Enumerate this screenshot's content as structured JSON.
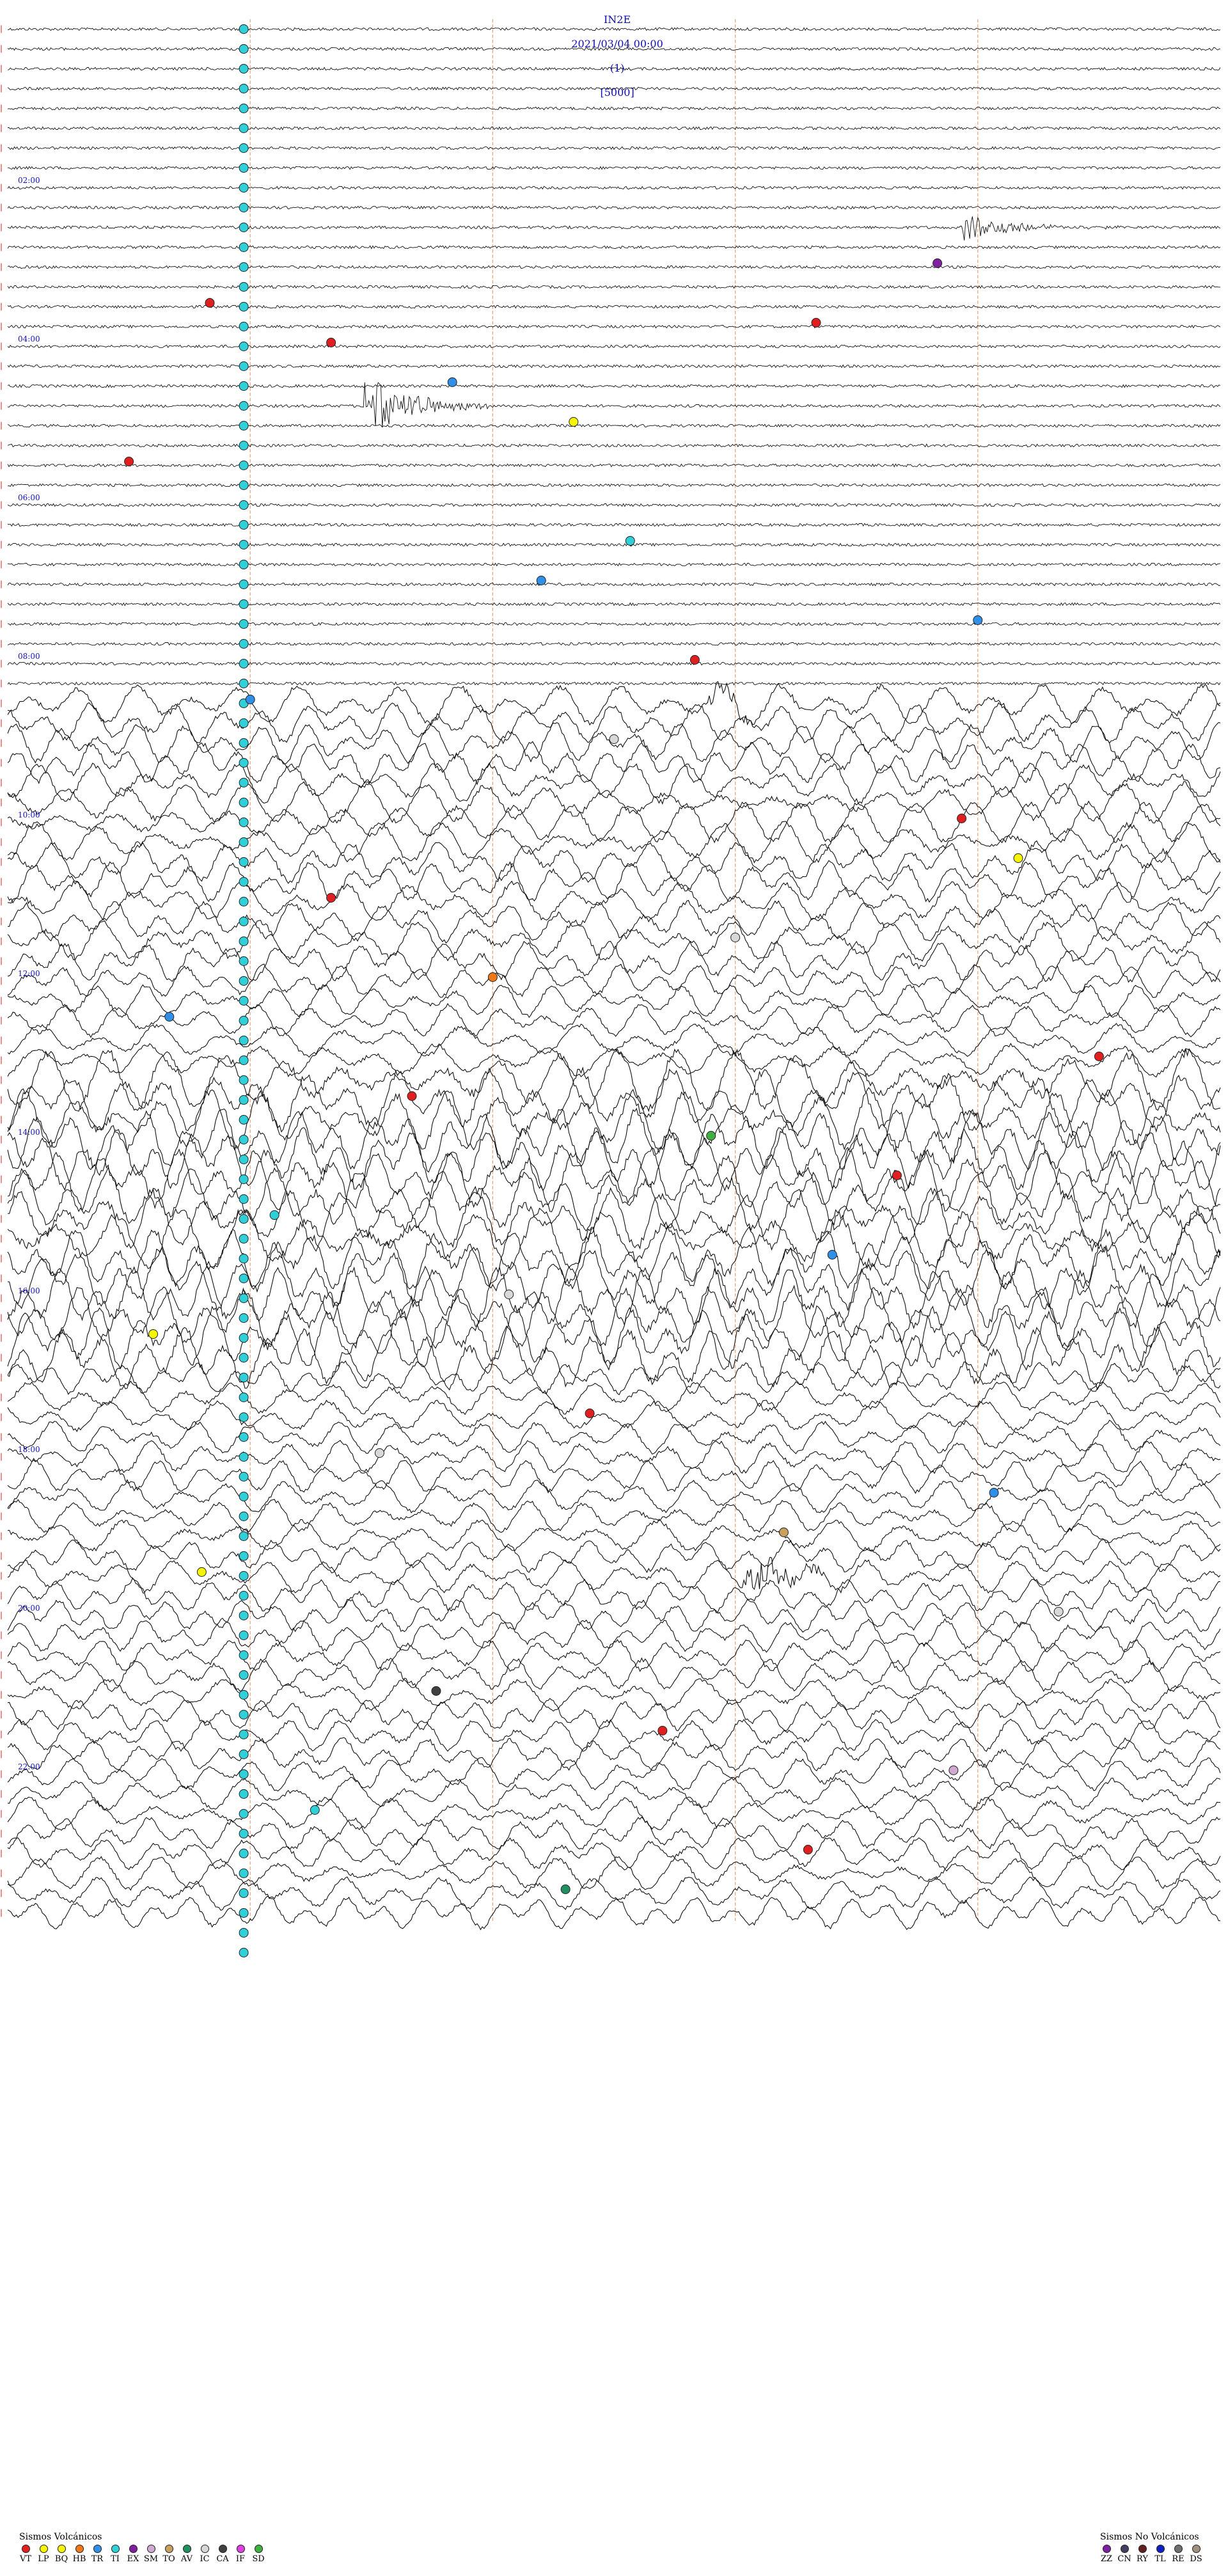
{
  "header": {
    "station": "IN2E",
    "datetime": "2021/03/04 00:00",
    "filter": "(1)",
    "scale": "[5000]"
  },
  "chart_data": {
    "type": "line",
    "time_labels": [
      "02:00",
      "04:00",
      "06:00",
      "08:00",
      "10:00",
      "12:00",
      "14:00",
      "16:00",
      "18:00",
      "20:00",
      "22:00"
    ],
    "rows": 96,
    "minutes_per_row": 15,
    "quiet_hours": [
      0,
      8.5
    ],
    "noisy_hours": [
      8.5,
      24
    ],
    "events": [
      {
        "row": 12,
        "minute": 11.5,
        "type": "EX"
      },
      {
        "row": 14,
        "minute": 2.5,
        "type": "VT"
      },
      {
        "row": 16,
        "minute": 4,
        "type": "VT"
      },
      {
        "row": 15,
        "minute": 10,
        "type": "VT"
      },
      {
        "row": 18,
        "minute": 5.5,
        "type": "TR"
      },
      {
        "row": 20,
        "minute": 7,
        "type": "BQ"
      },
      {
        "row": 22,
        "minute": 1.5,
        "type": "VT"
      },
      {
        "row": 26,
        "minute": 7.7,
        "type": "TI"
      },
      {
        "row": 28,
        "minute": 6.6,
        "type": "TR"
      },
      {
        "row": 30,
        "minute": 12,
        "type": "TR"
      },
      {
        "row": 32,
        "minute": 8.5,
        "type": "VT"
      },
      {
        "row": 34,
        "minute": 3,
        "type": "TR"
      },
      {
        "row": 36,
        "minute": 7.5,
        "type": "IC"
      },
      {
        "row": 40,
        "minute": 11.8,
        "type": "VT"
      },
      {
        "row": 42,
        "minute": 12.5,
        "type": "BQ"
      },
      {
        "row": 44,
        "minute": 4,
        "type": "VT"
      },
      {
        "row": 46,
        "minute": 9,
        "type": "IC"
      },
      {
        "row": 48,
        "minute": 6,
        "type": "HB"
      },
      {
        "row": 50,
        "minute": 2,
        "type": "TR"
      },
      {
        "row": 52,
        "minute": 13.5,
        "type": "VT"
      },
      {
        "row": 54,
        "minute": 5,
        "type": "VT"
      },
      {
        "row": 56,
        "minute": 8.7,
        "type": "SD"
      },
      {
        "row": 58,
        "minute": 11,
        "type": "VT"
      },
      {
        "row": 60,
        "minute": 3.3,
        "type": "TI"
      },
      {
        "row": 62,
        "minute": 10.2,
        "type": "TR"
      },
      {
        "row": 64,
        "minute": 6.2,
        "type": "IC"
      },
      {
        "row": 66,
        "minute": 1.8,
        "type": "BQ"
      },
      {
        "row": 70,
        "minute": 7.2,
        "type": "VT"
      },
      {
        "row": 72,
        "minute": 4.6,
        "type": "IC"
      },
      {
        "row": 74,
        "minute": 12.2,
        "type": "TR"
      },
      {
        "row": 76,
        "minute": 9.6,
        "type": "TO"
      },
      {
        "row": 78,
        "minute": 2.4,
        "type": "LP"
      },
      {
        "row": 80,
        "minute": 13,
        "type": "IC"
      },
      {
        "row": 84,
        "minute": 5.3,
        "type": "CA"
      },
      {
        "row": 86,
        "minute": 8.1,
        "type": "VT"
      },
      {
        "row": 88,
        "minute": 11.7,
        "type": "SM"
      },
      {
        "row": 90,
        "minute": 3.8,
        "type": "TI"
      },
      {
        "row": 92,
        "minute": 9.9,
        "type": "VT"
      },
      {
        "row": 94,
        "minute": 6.9,
        "type": "AV"
      }
    ],
    "signals": [
      {
        "row": 10,
        "minute": 11.8,
        "amp": 1.2
      },
      {
        "row": 19,
        "minute": 4.4,
        "amp": 2.6
      },
      {
        "row": 34,
        "minute": 8.6,
        "amp": 1.0
      },
      {
        "row": 78,
        "minute": 9.1,
        "amp": 1.8
      }
    ]
  },
  "legend_volcanic": {
    "title": "Sismos Volcánicos",
    "items": [
      {
        "code": "VT",
        "color": "#e02020"
      },
      {
        "code": "LP",
        "color": "#f5f500"
      },
      {
        "code": "BQ",
        "color": "#f5f500"
      },
      {
        "code": "HB",
        "color": "#f07818"
      },
      {
        "code": "TR",
        "color": "#3090e8"
      },
      {
        "code": "TI",
        "color": "#30d0d8"
      },
      {
        "code": "EX",
        "color": "#8020a0"
      },
      {
        "code": "SM",
        "color": "#d0a8d0"
      },
      {
        "code": "TO",
        "color": "#c8a060"
      },
      {
        "code": "AV",
        "color": "#209060"
      },
      {
        "code": "IC",
        "color": "#d8d8d8"
      },
      {
        "code": "CA",
        "color": "#404040"
      },
      {
        "code": "IF",
        "color": "#e040e0"
      },
      {
        "code": "SD",
        "color": "#40b040"
      }
    ]
  },
  "legend_nonvolcanic": {
    "title": "Sismos No Volcánicos",
    "items": [
      {
        "code": "ZZ",
        "color": "#8020a0"
      },
      {
        "code": "CN",
        "color": "#404060"
      },
      {
        "code": "RY",
        "color": "#602020"
      },
      {
        "code": "TL",
        "color": "#1020c0"
      },
      {
        "code": "RE",
        "color": "#707070"
      },
      {
        "code": "DS",
        "color": "#a09080"
      }
    ]
  }
}
